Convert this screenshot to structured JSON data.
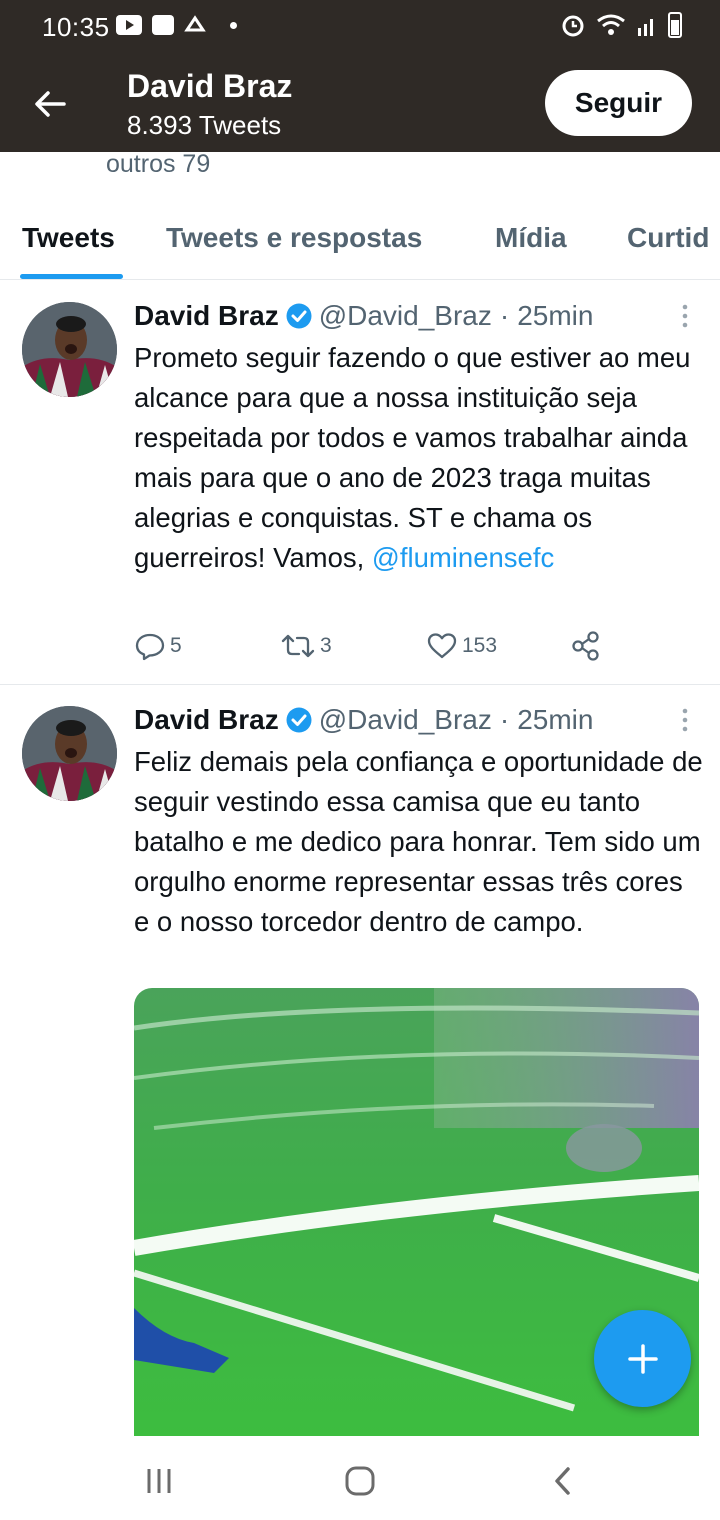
{
  "status_bar": {
    "time": "10:35",
    "left_icons": [
      "youtube-icon",
      "gallery-icon",
      "app-icon",
      "notification-dot"
    ],
    "right_icons": [
      "alarm-icon",
      "wifi-icon",
      "signal-icon",
      "battery-icon"
    ]
  },
  "header": {
    "name": "David Braz",
    "tweet_count": "8.393 Tweets",
    "follow_label": "Seguir"
  },
  "others_text": "outros 79",
  "tabs": [
    {
      "label": "Tweets",
      "active": true
    },
    {
      "label": "Tweets e respostas",
      "active": false
    },
    {
      "label": "Mídia",
      "active": false
    },
    {
      "label": "Curtid",
      "active": false
    }
  ],
  "tweets": [
    {
      "name": "David Braz",
      "handle": "@David_Braz",
      "sep": "·",
      "time": "25min",
      "text": "Prometo seguir fazendo o que estiver ao meu alcance para que a nossa instituição seja respeitada por todos e vamos trabalhar ainda mais para que o ano de 2023 traga muitas alegrias e conquistas. ST e chama os guerreiros! Vamos,",
      "mention": "@fluminensefc",
      "replies": "5",
      "retweets": "3",
      "likes": "153"
    },
    {
      "name": "David Braz",
      "handle": "@David_Braz",
      "sep": "·",
      "time": "25min",
      "text": "Feliz demais pela confiança e oportunidade de seguir vestindo essa camisa que eu tanto batalho e me dedico para honrar. Tem sido um orgulho enorme representar essas três cores e o nosso torcedor dentro de campo."
    }
  ],
  "colors": {
    "header_bg": "#2f2a26",
    "accent": "#1d9bf0",
    "secondary_text": "#536471"
  }
}
